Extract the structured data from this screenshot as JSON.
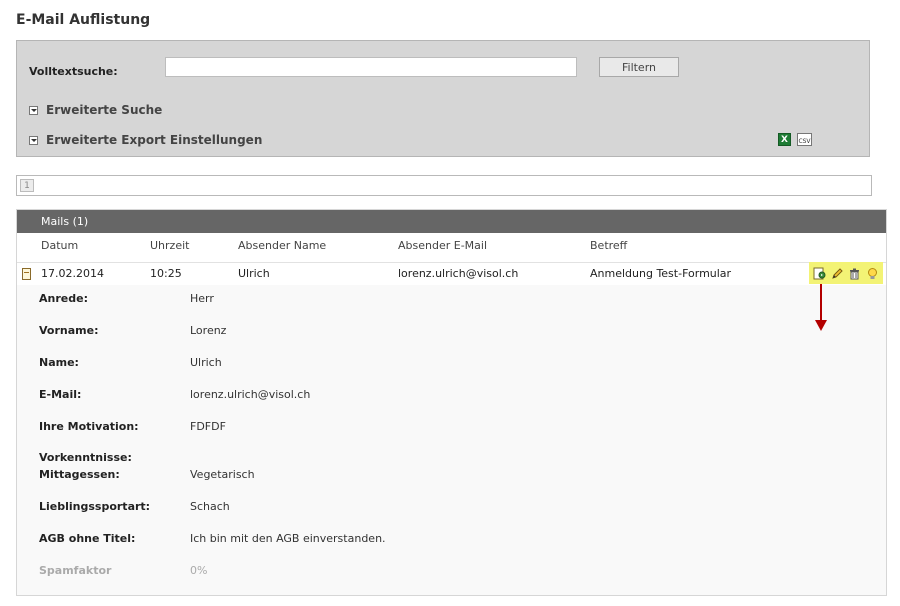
{
  "page": {
    "title": "E-Mail Auflistung"
  },
  "search": {
    "label": "Volltextsuche:",
    "value": "",
    "placeholder": "",
    "filter_label": "Filtern",
    "advanced_search_label": "Erweiterte Suche",
    "advanced_export_label": "Erweiterte Export Einstellungen",
    "export_icons": [
      "excel-icon",
      "csv-icon"
    ],
    "xls_glyph": "X",
    "csv_glyph": "CSV"
  },
  "pagination": {
    "current_page": "1"
  },
  "mails": {
    "header": "Mails (1)",
    "columns": [
      "Datum",
      "Uhrzeit",
      "Absender Name",
      "Absender E-Mail",
      "Betreff"
    ],
    "rows": [
      {
        "date": "17.02.2014",
        "time": "10:25",
        "sender_name": "Ulrich",
        "sender_email": "lorenz.ulrich@visol.ch",
        "subject": "Anmeldung Test-Formular",
        "actions": [
          "view-icon",
          "edit-icon",
          "delete-icon",
          "bulb-icon"
        ],
        "details": [
          {
            "label": "Anrede:",
            "value": "Herr"
          },
          {
            "label": "Vorname:",
            "value": "Lorenz"
          },
          {
            "label": "Name:",
            "value": "Ulrich"
          },
          {
            "label": "E-Mail:",
            "value": "lorenz.ulrich@visol.ch"
          },
          {
            "label": "Ihre Motivation:",
            "value": "FDFDF"
          },
          {
            "label": "Vorkenntnisse:",
            "value": ""
          },
          {
            "label": "Mittagessen:",
            "value": "Vegetarisch"
          },
          {
            "label": "Lieblingssportart:",
            "value": "Schach"
          },
          {
            "label": "AGB ohne Titel:",
            "value": "Ich bin mit den AGB einverstanden."
          },
          {
            "label": "Spamfaktor",
            "value": "0%"
          }
        ]
      }
    ]
  },
  "colors": {
    "header_bg": "#666666",
    "action_highlight": "#f3f375",
    "arrow": "#b30000"
  }
}
